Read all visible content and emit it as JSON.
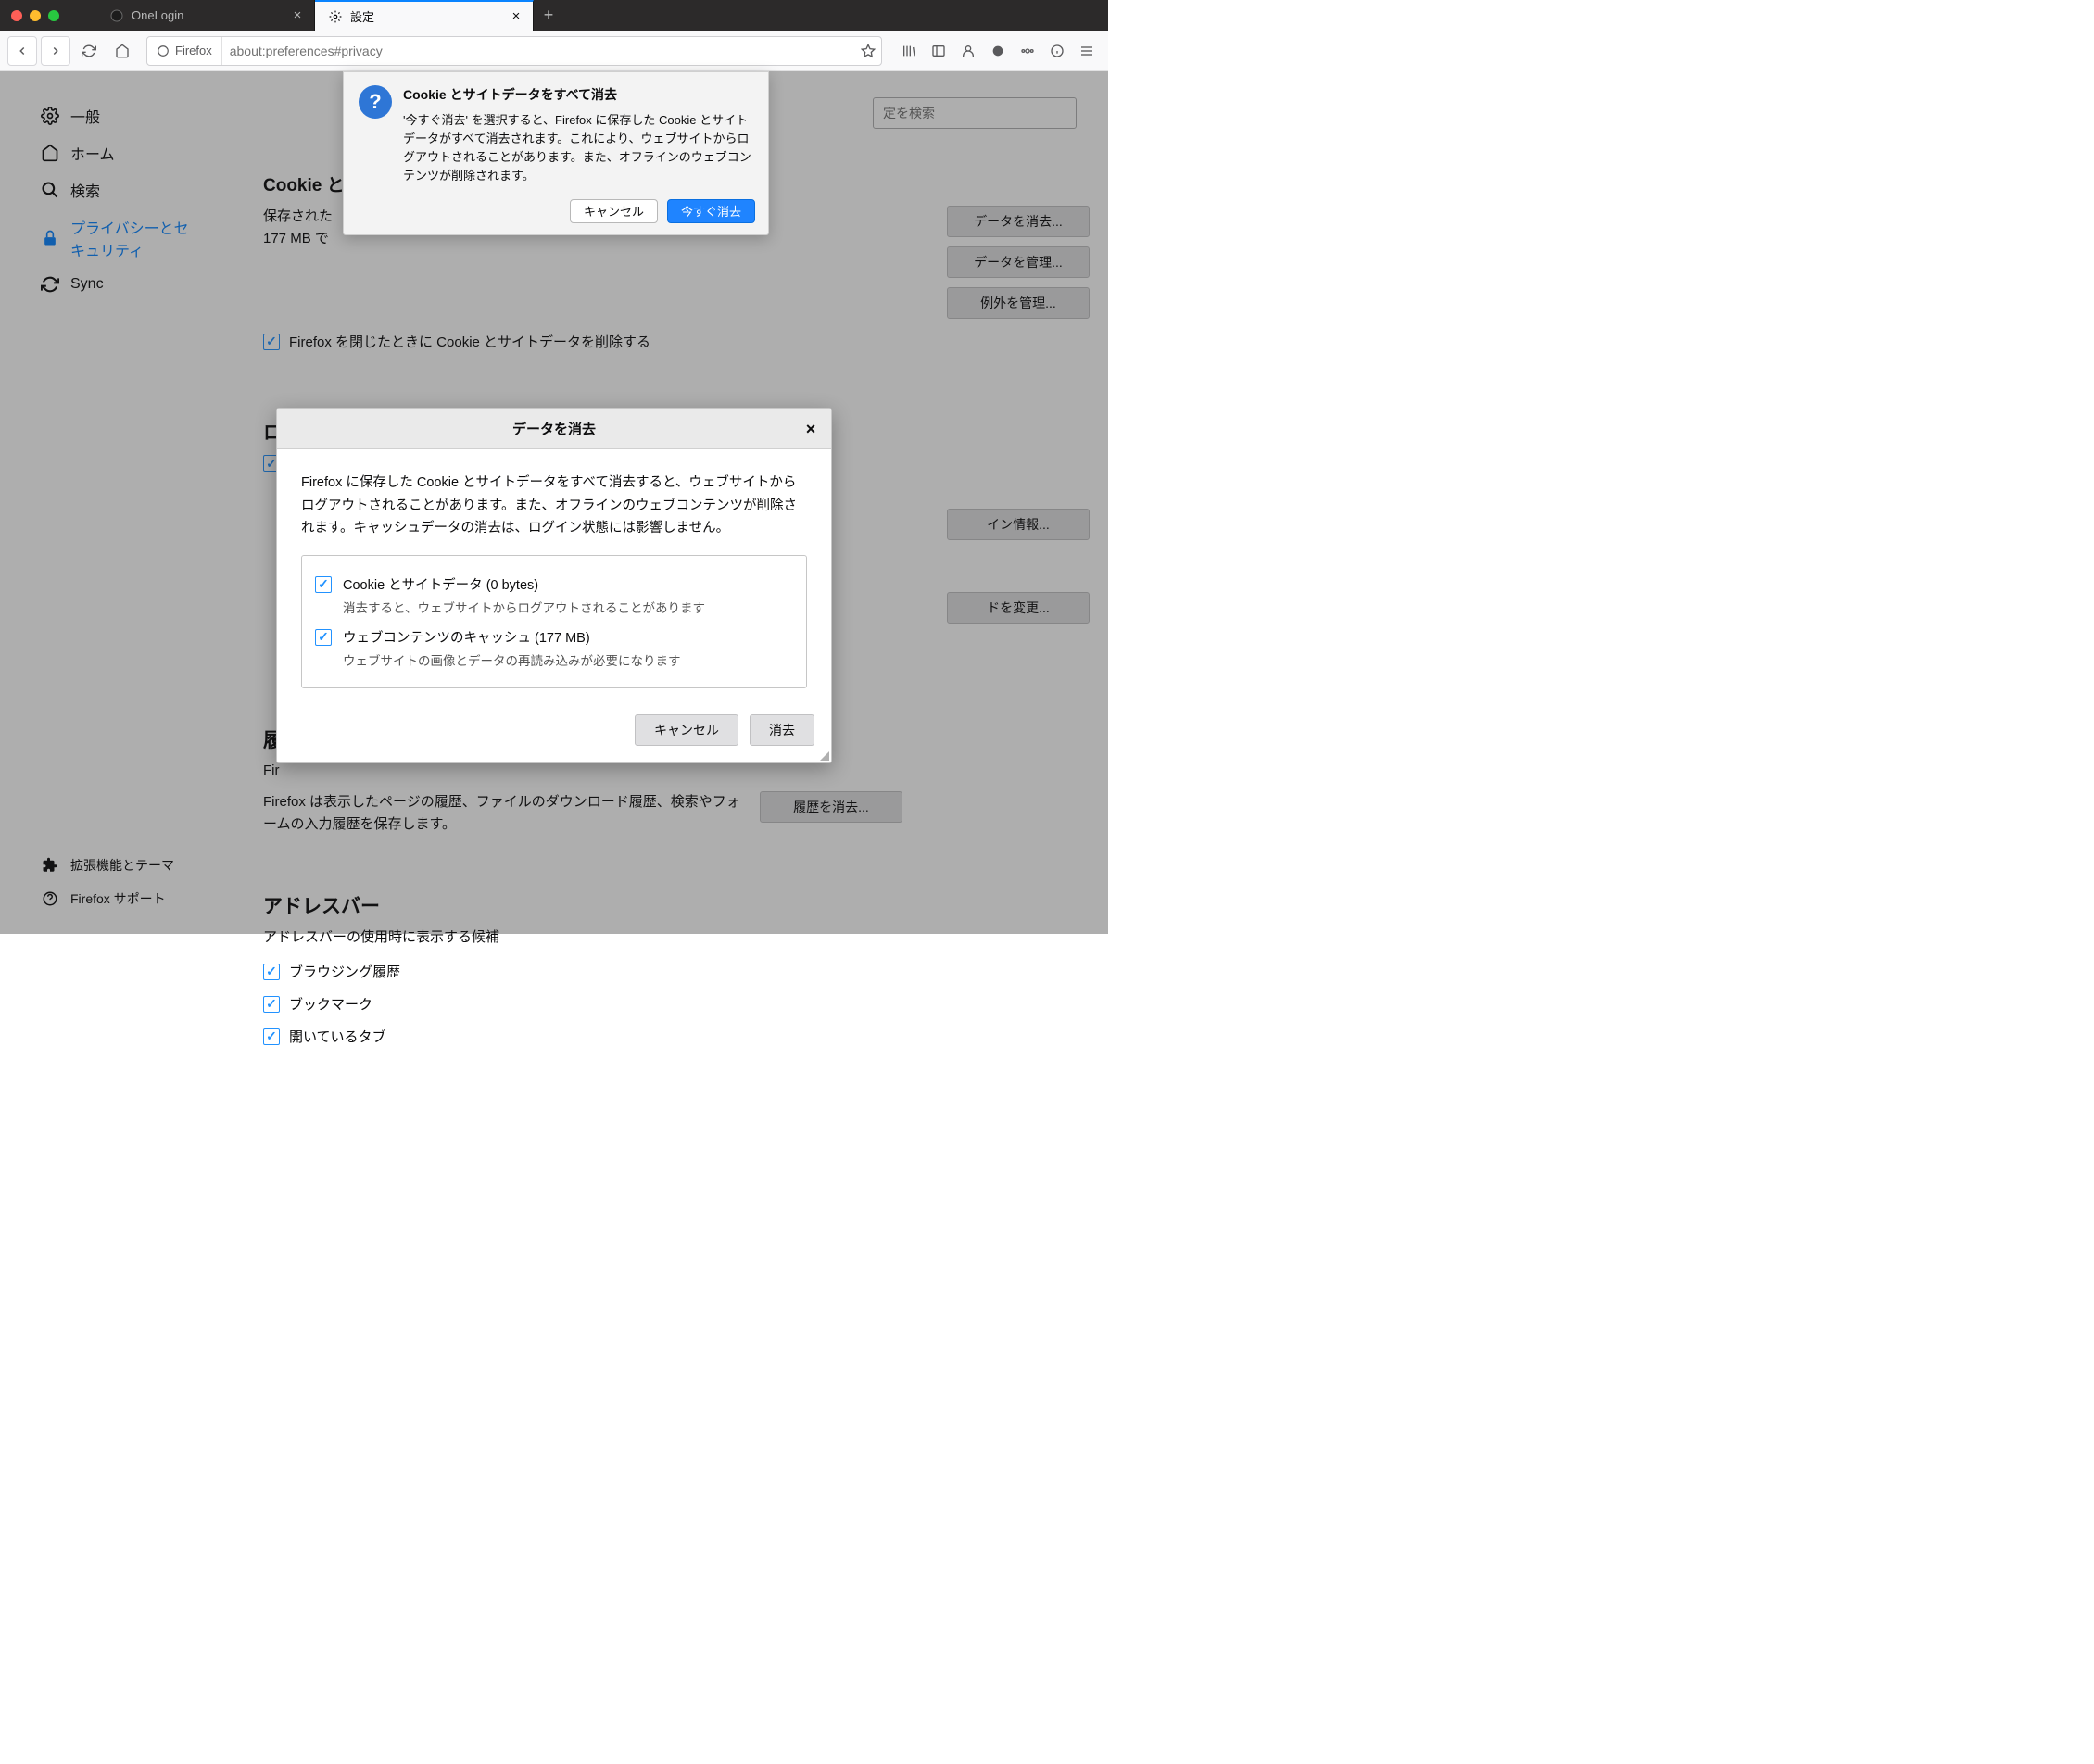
{
  "window": {
    "tabs": [
      {
        "label": "OneLogin"
      },
      {
        "label": "設定"
      }
    ]
  },
  "urlbar": {
    "identity": "Firefox",
    "url": "about:preferences#privacy"
  },
  "sidebar": {
    "items": [
      {
        "label": "一般"
      },
      {
        "label": "ホーム"
      },
      {
        "label": "検索"
      },
      {
        "label": "プライバシーとセキュリティ"
      },
      {
        "label": "Sync"
      }
    ],
    "footer": [
      {
        "label": "拡張機能とテーマ"
      },
      {
        "label": "Firefox サポート"
      }
    ]
  },
  "search_placeholder": "定を検索",
  "cookies": {
    "heading": "Cookie と",
    "saved_line1": "保存された",
    "saved_line2": "177 MB で",
    "delete_on_close": "Firefox を閉じたときに Cookie とサイトデータを削除する",
    "buttons": {
      "clear": "データを消去...",
      "manage": "データを管理...",
      "exceptions": "例外を管理..."
    }
  },
  "logins": {
    "btn_saved": "イン情報...",
    "btn_change": "ドを変更..."
  },
  "history": {
    "heading": "履",
    "line_prefix": "Fir",
    "desc": "Firefox は表示したページの履歴、ファイルのダウンロード履歴、検索やフォームの入力履歴を保存します。",
    "clear_btn": "履歴を消去..."
  },
  "addressbar": {
    "heading": "アドレスバー",
    "desc": "アドレスバーの使用時に表示する候補",
    "opts": [
      "ブラウジング履歴",
      "ブックマーク",
      "開いているタブ"
    ]
  },
  "alert": {
    "title": "Cookie とサイトデータをすべて消去",
    "body": "'今すぐ消去' を選択すると、Firefox に保存した Cookie とサイトデータがすべて消去されます。これにより、ウェブサイトからログアウトされることがあります。また、オフラインのウェブコンテンツが削除されます。",
    "cancel": "キャンセル",
    "confirm": "今すぐ消去"
  },
  "dialog": {
    "title": "データを消去",
    "body1": "Firefox に保存した Cookie とサイトデータをすべて消去すると、ウェブサイトからログアウトされることがあります。また、オフラインのウェブコンテンツが削除されます。キャッシュデータの消去は、ログイン状態には影響しません。",
    "opt1": {
      "label": "Cookie とサイトデータ (0 bytes)",
      "sub": "消去すると、ウェブサイトからログアウトされることがあります"
    },
    "opt2": {
      "label": "ウェブコンテンツのキャッシュ (177 MB)",
      "sub": "ウェブサイトの画像とデータの再読み込みが必要になります"
    },
    "cancel": "キャンセル",
    "clear": "消去"
  }
}
